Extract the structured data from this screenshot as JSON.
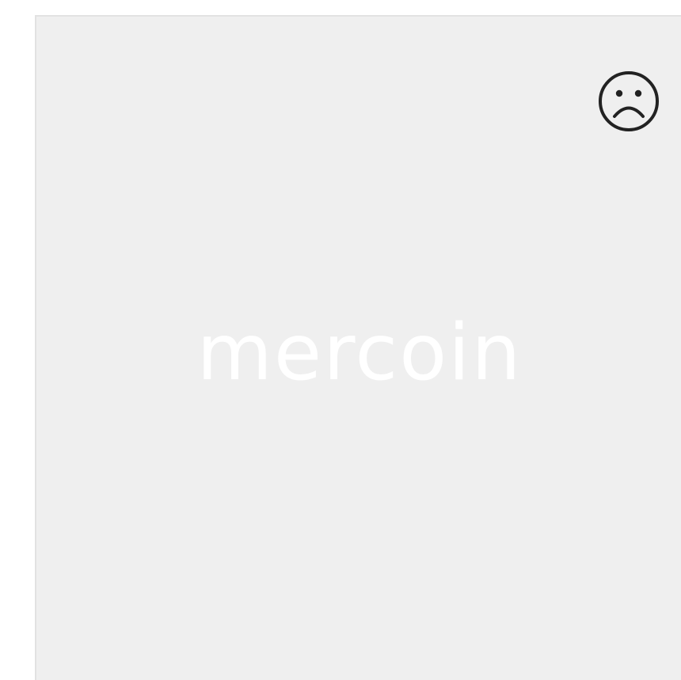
{
  "placeholder": {
    "status_icon": "sad-face-icon",
    "brand_text": "mercoin"
  },
  "colors": {
    "card_background": "#efefef",
    "card_border": "#e2e2e2",
    "icon": "#222222",
    "brand_text": "#ffffff"
  }
}
